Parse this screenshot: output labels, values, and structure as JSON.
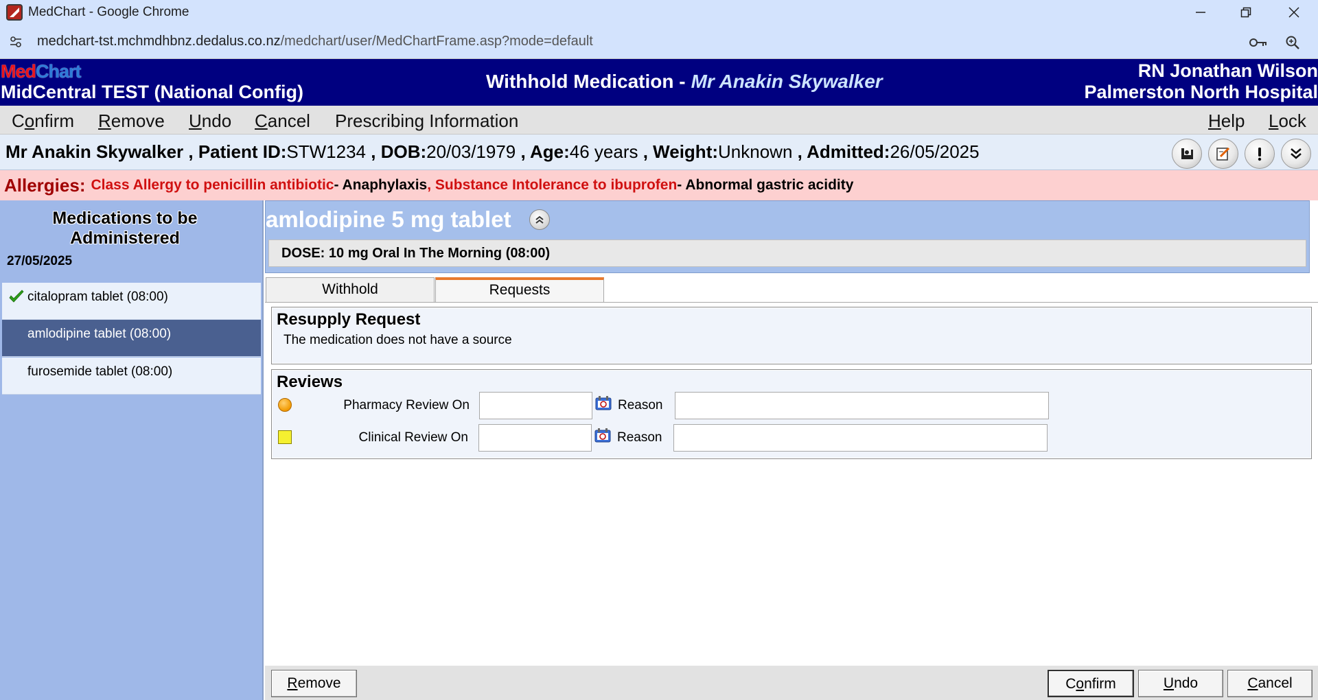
{
  "browser": {
    "window_title": "MedChart - Google Chrome",
    "url_host": "medchart-tst.mchmdhbnz.dedalus.co.nz",
    "url_path": "/medchart/user/MedChartFrame.asp?mode=default",
    "controls": {
      "minimize": "—",
      "restore": "❐",
      "close": "✕"
    },
    "icons": [
      "site-info-icon",
      "password-key-icon",
      "zoom-icon"
    ]
  },
  "header": {
    "logo_med": "Med",
    "logo_chart": "Chart",
    "ward": "MidCentral TEST (National Config)",
    "title": "Withhold Medication -",
    "patient_name": "Mr Anakin Skywalker",
    "user": "RN Jonathan Wilson",
    "hospital": "Palmerston North Hospital"
  },
  "menu": {
    "confirm_pre": "C",
    "confirm_u": "o",
    "confirm_post": "nfirm",
    "remove_u": "R",
    "remove_post": "emove",
    "undo_u": "U",
    "undo_post": "ndo",
    "cancel_u": "C",
    "cancel_post": "ancel",
    "prescribing": "Prescribing Information",
    "help_u": "H",
    "help_post": "elp",
    "lock_u": "L",
    "lock_post": "ock"
  },
  "patient": {
    "name": "Mr Anakin Skywalker",
    "id_label": "Patient ID:",
    "id": "STW1234",
    "dob_label": "DOB:",
    "dob": "20/03/1979",
    "age_label": "Age:",
    "age": "46 years",
    "weight_label": "Weight:",
    "weight": "Unknown",
    "admitted_label": "Admitted:",
    "admitted": "26/05/2025",
    "buttons": [
      "bed-icon",
      "edit-note-icon",
      "alert-icon",
      "expand-down-icon"
    ]
  },
  "allergies": {
    "label": "Allergies:",
    "items": [
      {
        "allergen": "Class Allergy to penicillin antibiotic",
        "reaction": " - Anaphylaxis"
      },
      {
        "allergen": ", Substance Intolerance to ibuprofen",
        "reaction": " - Abnormal gastric acidity"
      }
    ]
  },
  "left_pane": {
    "title_line1": "Medications to be",
    "title_line2": "Administered",
    "date": "27/05/2025",
    "medications": [
      {
        "label": "citalopram tablet (08:00)",
        "status": "administered"
      },
      {
        "label": "amlodipine tablet (08:00)",
        "status": "selected"
      },
      {
        "label": "furosemide tablet (08:00)",
        "status": "pending"
      }
    ]
  },
  "main": {
    "drug_name": "amlodipine 5 mg tablet",
    "dose": "DOSE: 10 mg Oral In The Morning (08:00)",
    "tabs": [
      {
        "label": "Withhold",
        "active": false
      },
      {
        "label": "Requests",
        "active": true
      }
    ],
    "resupply": {
      "title": "Resupply Request",
      "text": "The medication does not have a source"
    },
    "reviews": {
      "title": "Reviews",
      "pharmacy_label": "Pharmacy Review On",
      "pharmacy_date": "",
      "pharmacy_reason": "",
      "clinical_label": "Clinical Review On",
      "clinical_date": "",
      "clinical_reason": "",
      "reason_label": "Reason"
    }
  },
  "footer": {
    "remove_u": "R",
    "remove_post": "emove",
    "confirm_pre": "C",
    "confirm_u": "o",
    "confirm_post": "nfirm",
    "undo_u": "U",
    "undo_post": "ndo",
    "cancel_u": "C",
    "cancel_post": "ancel"
  },
  "colors": {
    "header_bg": "#000080",
    "left_pane_bg": "#9fb8e8",
    "selected_item_bg": "#4a6090",
    "allergy_bg": "#fdd0d0",
    "allergen_text": "#d01010",
    "active_tab_accent": "#e87a2e"
  }
}
